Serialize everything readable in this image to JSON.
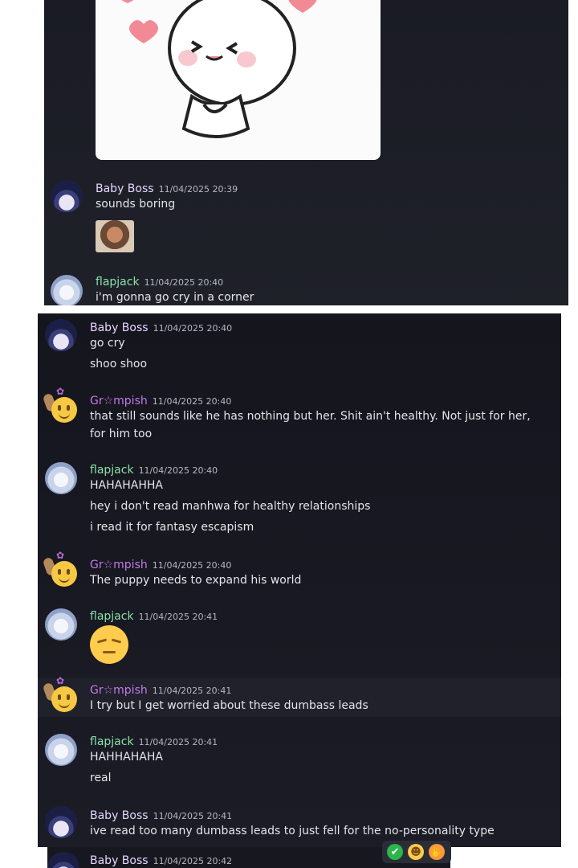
{
  "messages_top": [
    {
      "user": "Baby Boss",
      "time": "11/04/2025 20:39",
      "lines": [
        "sounds boring"
      ]
    },
    {
      "user": "flapjack",
      "time": "11/04/2025 20:40",
      "lines": [
        "i'm gonna go cry in a corner"
      ]
    }
  ],
  "messages_main": [
    {
      "user": "Baby Boss",
      "time": "11/04/2025 20:40",
      "lines": [
        "go cry",
        "shoo shoo"
      ]
    },
    {
      "user": "Gr☆mpish",
      "time": "11/04/2025 20:40",
      "lines": [
        "that still sounds like he has nothing but her. Shit ain't healthy. Not just for her, for him too"
      ]
    },
    {
      "user": "flapjack",
      "time": "11/04/2025 20:40",
      "lines": [
        "HAHAHAHHA",
        "hey i don't read manhwa for healthy relationships",
        "i read it for fantasy escapism"
      ]
    },
    {
      "user": "Gr☆mpish",
      "time": "11/04/2025 20:40",
      "lines": [
        "The puppy needs to expand his world"
      ]
    },
    {
      "user": "flapjack",
      "time": "11/04/2025 20:41",
      "emoji": "pensive-face"
    },
    {
      "user": "Gr☆mpish",
      "time": "11/04/2025 20:41",
      "lines": [
        "I try but I get worried about these dumbass leads"
      ]
    },
    {
      "user": "flapjack",
      "time": "11/04/2025 20:41",
      "lines": [
        "HAHHAHAHA",
        "real"
      ]
    },
    {
      "user": "Baby Boss",
      "time": "11/04/2025 20:41",
      "lines": [
        "ive read too many dumbass leads to just fell for the no-personality type"
      ]
    }
  ],
  "messages_bottom": [
    {
      "user": "Baby Boss",
      "time": "11/04/2025 20:42"
    }
  ],
  "reactions": [
    "check-mark-icon",
    "grin-emoji-icon",
    "hands-emoji-icon"
  ]
}
